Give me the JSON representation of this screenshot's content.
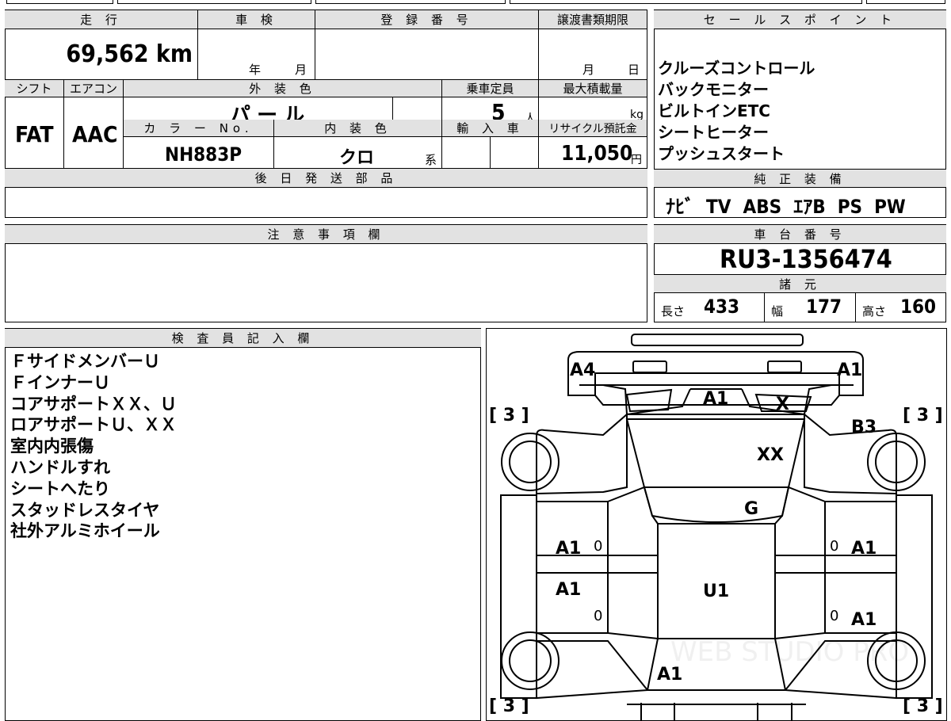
{
  "info": {
    "mileage_label": "走 行",
    "mileage": "69,562 km",
    "shaken_label": "車 検",
    "shaken_year": "年",
    "shaken_month": "月",
    "registration_label": "登 録 番 号",
    "transfer_label": "譲渡書類期限",
    "transfer_month": "月",
    "transfer_day": "日",
    "shift_label": "シフト",
    "shift": "FAT",
    "ac_label": "エアコン",
    "ac": "AAC",
    "exterior_color_label": "外 装 色",
    "exterior_color": "パ ー ル",
    "capacity_label": "乗車定員",
    "capacity": "5",
    "capacity_unit": "人",
    "max_load_label": "最大積載量",
    "max_load_unit": "kg",
    "color_no_label": "カ ラ ー No.",
    "color_no": "NH883P",
    "interior_color_label": "内 装 色",
    "interior_color": "クロ",
    "interior_suffix": "系",
    "import_label": "輸 入 車",
    "recycle_label": "リサイクル預託金",
    "recycle_fee": "11,050",
    "recycle_unit": "円",
    "later_parts_label": "後 日 発 送 部 品"
  },
  "sales_points": {
    "label": "セ ー ル ス ポ イ ン ト",
    "items": [
      "クルーズコントロール",
      "バックモニター",
      "ビルトインETC",
      "シートヒーター",
      "プッシュスタート"
    ]
  },
  "equipment": {
    "label": "純 正 装 備",
    "value": "ﾅﾋﾞ  TV  ABS  ｴｱB  PS  PW"
  },
  "caution": {
    "label": "注 意 事 項 欄"
  },
  "chassis": {
    "label": "車 台 番 号",
    "number": "RU3-1356474"
  },
  "specs": {
    "label": "諸 元",
    "length_label": "長さ",
    "length": "433",
    "width_label": "幅",
    "width": "177",
    "height_label": "高さ",
    "height": "160"
  },
  "inspector": {
    "label": "検 査 員 記 入 欄",
    "notes": [
      "ＦサイドメンバーＵ",
      "ＦインナーＵ",
      "コアサポートＸＸ、Ｕ",
      "ロアサポートＵ、ＸＸ",
      "室内内張傷",
      "ハンドルすれ",
      "シートへたり",
      "スタッドレスタイヤ",
      "社外アルミホイール"
    ]
  },
  "diagram": {
    "marks": {
      "front_left_corner": "A4",
      "front_right_corner": "A1",
      "hood_left": "A1",
      "hood_right": "X",
      "windshield_area": "XX",
      "cowl": "G",
      "front_door_left": "A1",
      "front_door_right": "A1",
      "rear_door_left": "A1",
      "rear_door_right": "A1",
      "roof": "U1",
      "tailgate": "A1",
      "right_front_fender": "B3",
      "front_left_tire": "[ 3 ]",
      "front_right_tire": "[ 3 ]",
      "rear_left_tire": "[ 3 ]",
      "rear_right_tire": "[ 3 ]",
      "left_zero_1": "0",
      "left_zero_2": "0",
      "right_zero_1": "0",
      "right_zero_2": "0"
    },
    "watermark": "WEB STUDIO PRO"
  }
}
